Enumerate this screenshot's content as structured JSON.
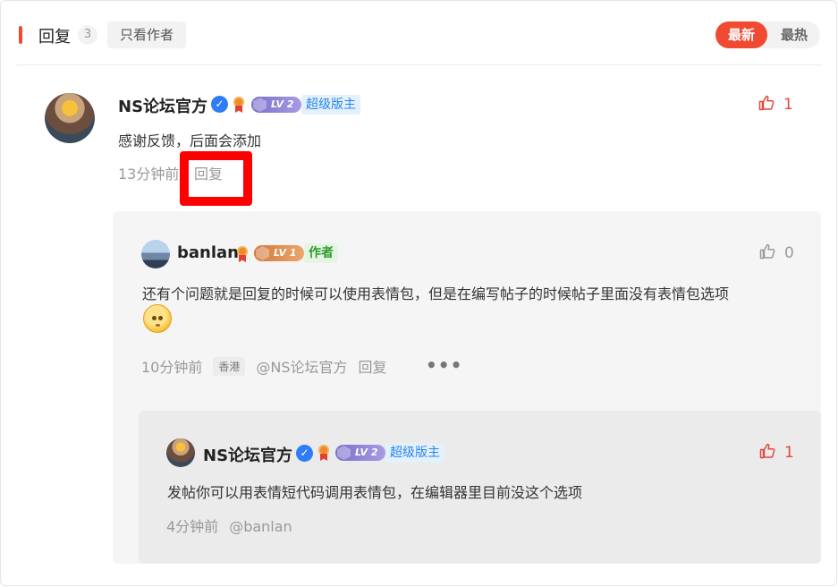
{
  "header": {
    "title": "回复",
    "count": "3",
    "author_only": "只看作者",
    "sort_new": "最新",
    "sort_hot": "最热"
  },
  "colors": {
    "accent": "#f04b32",
    "like_active": "#e2473a",
    "mod_tag": "#2a86e6",
    "author_tag": "#2f9a2f",
    "highlight_box": "#ff0000"
  },
  "comment": {
    "author": "NS论坛官方",
    "level": "LV 2",
    "role_tag": "超级版主",
    "likes": "1",
    "text": "感谢反馈，后面会添加",
    "time": "13分钟前",
    "reply_label": "回复"
  },
  "reply1": {
    "author": "banlan",
    "level": "LV 1",
    "role_tag": "作者",
    "likes": "0",
    "text": "还有个问题就是回复的时候可以使用表情包，但是在编写帖子的时候帖子里面没有表情包选项",
    "emoji": "smiling-face-emoji",
    "time": "10分钟前",
    "location": "香港",
    "mention": "@NS论坛官方",
    "reply_label": "回复",
    "more": "•••"
  },
  "reply2": {
    "author": "NS论坛官方",
    "level": "LV 2",
    "role_tag": "超级版主",
    "likes": "1",
    "text": "发帖你可以用表情短代码调用表情包，在编辑器里目前没这个选项",
    "time": "4分钟前",
    "mention": "@banlan"
  }
}
